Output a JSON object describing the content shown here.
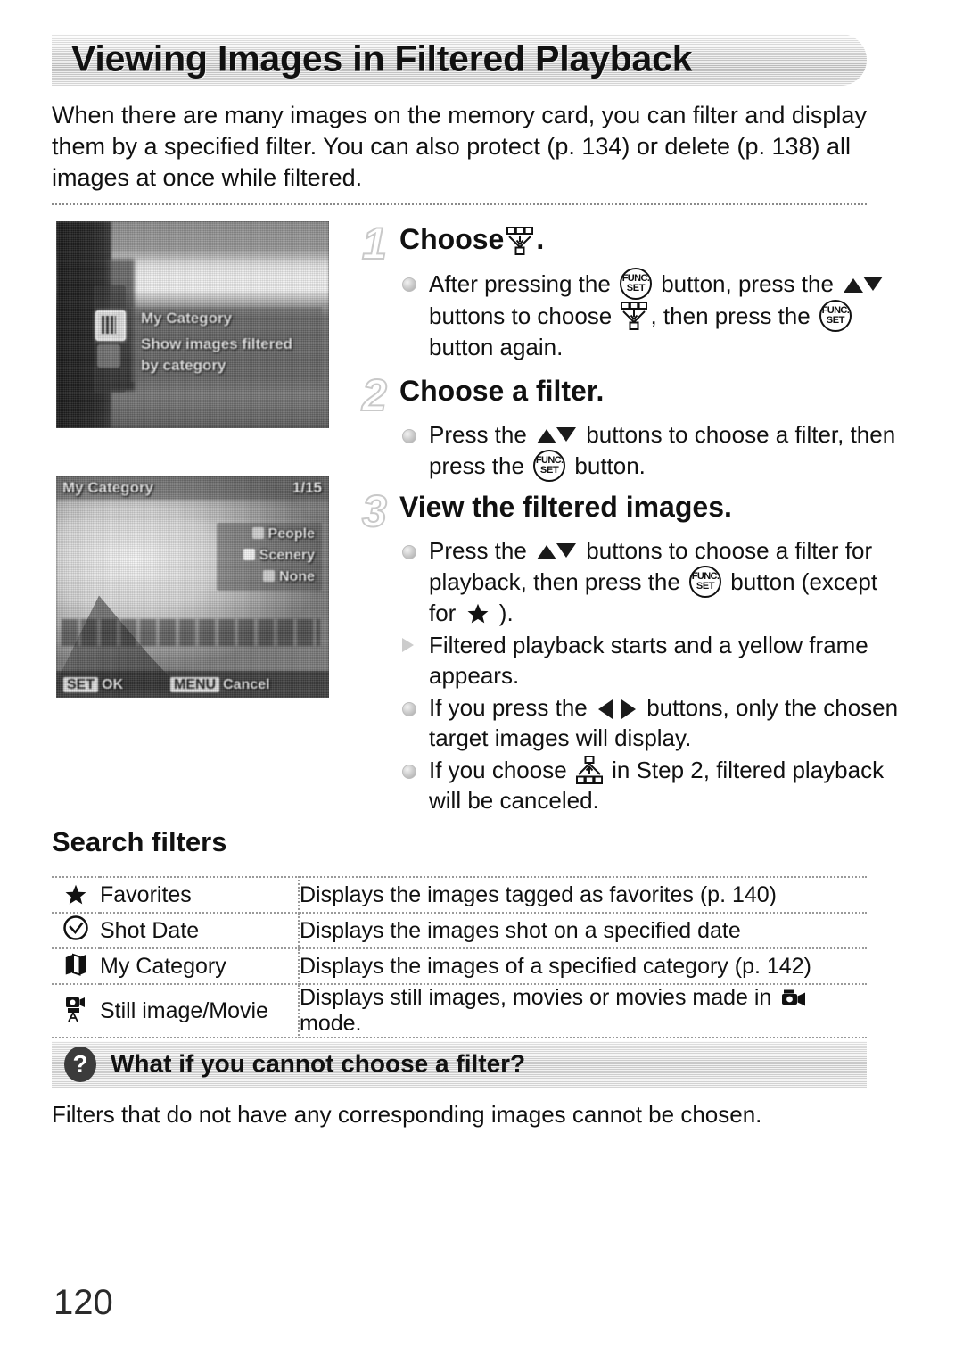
{
  "page": {
    "title": "Viewing Images in Filtered Playback",
    "number": "120",
    "intro": "When there are many images on the memory card, you can filter and display them by a specified filter. You can also protect (p. 134) or delete (p. 138) all images at once while filtered."
  },
  "steps": [
    {
      "number": "1",
      "heading_before": "Choose",
      "heading_after": ".",
      "heading_icon": "filter-icon",
      "bullets": [
        {
          "type": "dot",
          "parts": [
            {
              "t": "text",
              "v": "After pressing the "
            },
            {
              "t": "icon",
              "v": "funcset-button-icon"
            },
            {
              "t": "text",
              "v": " button, press the "
            },
            {
              "t": "icon",
              "v": "up-down-buttons-icon"
            },
            {
              "t": "text",
              "v": " buttons to choose "
            },
            {
              "t": "icon",
              "v": "filter-icon"
            },
            {
              "t": "text",
              "v": ", then press the "
            },
            {
              "t": "icon",
              "v": "funcset-button-icon"
            },
            {
              "t": "text",
              "v": " button again."
            }
          ]
        }
      ]
    },
    {
      "number": "2",
      "heading_before": "Choose a filter.",
      "heading_after": "",
      "heading_icon": "",
      "bullets": [
        {
          "type": "dot",
          "parts": [
            {
              "t": "text",
              "v": "Press the "
            },
            {
              "t": "icon",
              "v": "up-down-buttons-icon"
            },
            {
              "t": "text",
              "v": " buttons to choose a filter, then press the "
            },
            {
              "t": "icon",
              "v": "funcset-button-icon"
            },
            {
              "t": "text",
              "v": " button."
            }
          ]
        }
      ]
    },
    {
      "number": "3",
      "heading_before": "View the filtered images.",
      "heading_after": "",
      "heading_icon": "",
      "bullets": [
        {
          "type": "dot",
          "parts": [
            {
              "t": "text",
              "v": "Press the "
            },
            {
              "t": "icon",
              "v": "up-down-buttons-icon"
            },
            {
              "t": "text",
              "v": " buttons to choose a filter for playback, then press the "
            },
            {
              "t": "icon",
              "v": "funcset-button-icon"
            },
            {
              "t": "text",
              "v": " button (except for "
            },
            {
              "t": "icon",
              "v": "star-icon"
            },
            {
              "t": "text",
              "v": " )."
            }
          ]
        },
        {
          "type": "triangle",
          "parts": [
            {
              "t": "text",
              "v": "Filtered playback starts and a yellow frame appears."
            }
          ]
        },
        {
          "type": "dot",
          "parts": [
            {
              "t": "text",
              "v": "If you press the "
            },
            {
              "t": "icon",
              "v": "left-right-buttons-icon"
            },
            {
              "t": "text",
              "v": " buttons, only the chosen target images will display."
            }
          ]
        },
        {
          "type": "dot",
          "parts": [
            {
              "t": "text",
              "v": "If you choose "
            },
            {
              "t": "icon",
              "v": "cancel-filter-icon"
            },
            {
              "t": "text",
              "v": " in Step 2, filtered playback will be canceled."
            }
          ]
        }
      ]
    }
  ],
  "screens": {
    "screen1": {
      "menu_label": "My Category",
      "desc_line1": "Show images filtered",
      "desc_line2": "by category"
    },
    "screen2": {
      "title": "My Category",
      "counter": "1/15",
      "options": [
        "People",
        "Scenery",
        "None"
      ],
      "hint_set_key": "SET",
      "hint_set_label": "OK",
      "hint_menu_key": "MENU",
      "hint_menu_label": "Cancel"
    }
  },
  "search_filters": {
    "heading": "Search filters",
    "rows": [
      {
        "icon": "star-icon",
        "name": "Favorites",
        "desc_before": "Displays the images tagged as favorites (p. 140)",
        "desc_icon": "",
        "desc_after": ""
      },
      {
        "icon": "clock-check-icon",
        "name": "Shot Date",
        "desc_before": "Displays the images shot on a specified date",
        "desc_icon": "",
        "desc_after": ""
      },
      {
        "icon": "book-stack-icon",
        "name": "My Category",
        "desc_before": "Displays the images of a specified category (p. 142)",
        "desc_icon": "",
        "desc_after": ""
      },
      {
        "icon": "movie-camera-tripod-icon",
        "name": "Still image/Movie",
        "desc_before": "Displays still images, movies or movies made in ",
        "desc_icon": "movie-camera-icon",
        "desc_after": " mode."
      }
    ]
  },
  "callout": {
    "icon": "question-mark-icon",
    "title": "What if you cannot choose a filter?",
    "body": "Filters that do not have any corresponding images cannot be chosen."
  }
}
